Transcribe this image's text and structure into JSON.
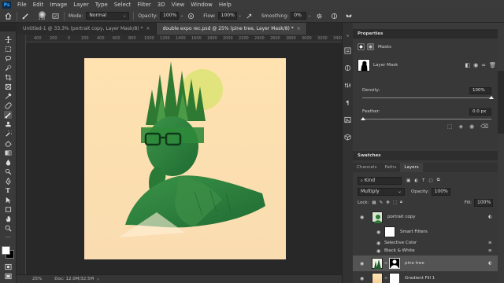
{
  "menubar": {
    "logo": "Ps",
    "items": [
      "File",
      "Edit",
      "Image",
      "Layer",
      "Type",
      "Select",
      "Filter",
      "3D",
      "View",
      "Window",
      "Help"
    ]
  },
  "options": {
    "brush_size": "250",
    "mode_label": "Mode:",
    "mode_value": "Normal",
    "opacity_label": "Opacity:",
    "opacity_value": "100%",
    "flow_label": "Flow:",
    "flow_value": "100%",
    "smoothing_label": "Smoothing:",
    "smoothing_value": "0%"
  },
  "tabs": [
    {
      "label": "Untitled-1 @ 33.3% (portrait copy, Layer Mask/8) *",
      "active": false
    },
    {
      "label": "double expo rec.psd @ 25% (pine tree, Layer Mask/8) *",
      "active": true
    }
  ],
  "ruler": {
    "top_ticks": [
      "400",
      "200",
      "0",
      "200",
      "400",
      "600",
      "800",
      "1000",
      "1200",
      "1400",
      "1600",
      "1800",
      "2000",
      "2200",
      "2400",
      "2600",
      "2800",
      "3000",
      "3200",
      "3400"
    ]
  },
  "status": {
    "zoom": "25%",
    "doc": "Doc: 12.0M/32.5M"
  },
  "properties": {
    "title": "Properties",
    "masks_label": "Masks",
    "layer_mask_label": "Layer Mask",
    "density_label": "Density:",
    "density_value": "100%",
    "feather_label": "Feather:",
    "feather_value": "0.0 px"
  },
  "swatches": {
    "title": "Swatches",
    "subtabs": [
      "Channels",
      "Paths",
      "Layers"
    ],
    "active_subtab": "Layers",
    "kind_label": "Kind",
    "blend_mode": "Multiply",
    "opacity_label": "Opacity:",
    "opacity_value": "100%",
    "lock_label": "Lock:",
    "fill_label": "Fill:",
    "fill_value": "100%"
  },
  "layers": [
    {
      "name": "portrait copy",
      "type": "smart"
    },
    {
      "name": "Smart Filters",
      "type": "filter-group"
    },
    {
      "name": "Selective Color",
      "type": "filter"
    },
    {
      "name": "Black & White",
      "type": "filter"
    },
    {
      "name": "pine tree",
      "type": "masked"
    },
    {
      "name": "Gradient Fill 1",
      "type": "fill"
    }
  ],
  "colors": {
    "accent": "#31a8ff",
    "canvas_bg": "#282828",
    "document_bg": "#fde5b9",
    "green_tint": "#2f8a3a"
  }
}
